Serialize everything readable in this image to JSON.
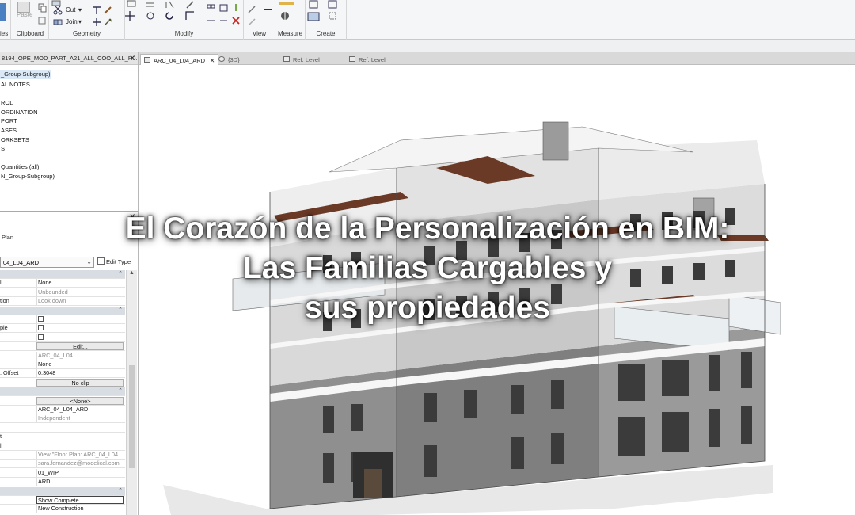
{
  "ribbon": {
    "groups": {
      "clipboard": "Clipboard",
      "geometry": "Geometry",
      "modify": "Modify",
      "view": "View",
      "measure": "Measure",
      "create": "Create",
      "properties_partial": "ies"
    },
    "small_labels": {
      "paste": "Paste",
      "cut": "Cut",
      "join": "Join"
    }
  },
  "browser": {
    "title": "8194_OPE_MOD_PART_A21_ALL_COO_ALL_R0...",
    "items": [
      "_Group-Subgroup)",
      "AL NOTES",
      "",
      "ROL",
      "ORDINATION",
      "PORT",
      "ASES",
      "ORKSETS",
      "S",
      "",
      "Quantities (all)",
      "N_Group-Subgroup)"
    ]
  },
  "tabs": [
    {
      "label": "ARC_04_L04_ARD",
      "active": true
    },
    {
      "label": "{3D}",
      "active": false
    },
    {
      "label": "Ref. Level",
      "active": false
    },
    {
      "label": "Ref. Level",
      "active": false
    }
  ],
  "properties": {
    "type_label": "Plan",
    "selector_value": "04_L04_ARD",
    "edit_type": "Edit Type",
    "rows": [
      {
        "k": "",
        "v": "",
        "kind": "group"
      },
      {
        "k": "l",
        "v": "None",
        "kind": "value"
      },
      {
        "k": "",
        "v": "Unbounded",
        "kind": "grey"
      },
      {
        "k": "tion",
        "v": "Look down",
        "kind": "grey"
      },
      {
        "k": "",
        "v": "",
        "kind": "group"
      },
      {
        "k": "",
        "v": "",
        "kind": "check"
      },
      {
        "k": "ple",
        "v": "",
        "kind": "check"
      },
      {
        "k": "",
        "v": "",
        "kind": "check"
      },
      {
        "k": "",
        "v": "Edit...",
        "kind": "button"
      },
      {
        "k": "",
        "v": "ARC_04_L04",
        "kind": "grey"
      },
      {
        "k": "",
        "v": "None",
        "kind": "value"
      },
      {
        "k": ": Offset",
        "v": "0.3048",
        "kind": "value"
      },
      {
        "k": "",
        "v": "No clip",
        "kind": "button"
      },
      {
        "k": "",
        "v": "",
        "kind": "group"
      },
      {
        "k": "",
        "v": "<None>",
        "kind": "button"
      },
      {
        "k": "",
        "v": "ARC_04_L04_ARD",
        "kind": "value"
      },
      {
        "k": "",
        "v": "Independent",
        "kind": "grey"
      },
      {
        "k": "",
        "v": "",
        "kind": "value"
      },
      {
        "k": "t",
        "v": "",
        "kind": "value"
      },
      {
        "k": "l",
        "v": "",
        "kind": "value"
      },
      {
        "k": "",
        "v": "View \"Floor Plan: ARC_04_L04...",
        "kind": "grey"
      },
      {
        "k": "",
        "v": "sara.fernandez@modelical.com",
        "kind": "grey"
      },
      {
        "k": "",
        "v": "01_WIP",
        "kind": "value"
      },
      {
        "k": "",
        "v": "ARD",
        "kind": "value"
      },
      {
        "k": "",
        "v": "",
        "kind": "group"
      },
      {
        "k": "",
        "v": "Show Complete",
        "kind": "boxed"
      },
      {
        "k": "",
        "v": "New Construction",
        "kind": "value"
      }
    ]
  },
  "headline": {
    "line1": "El Corazón de la Personalización en BIM:",
    "line2": "Las Familias Cargables y",
    "line3": "sus propiedades"
  },
  "colors": {
    "accent_wood": "#6b3a26",
    "facade_grey": "#8c8c8c",
    "facade_white": "#f2f2f2"
  }
}
